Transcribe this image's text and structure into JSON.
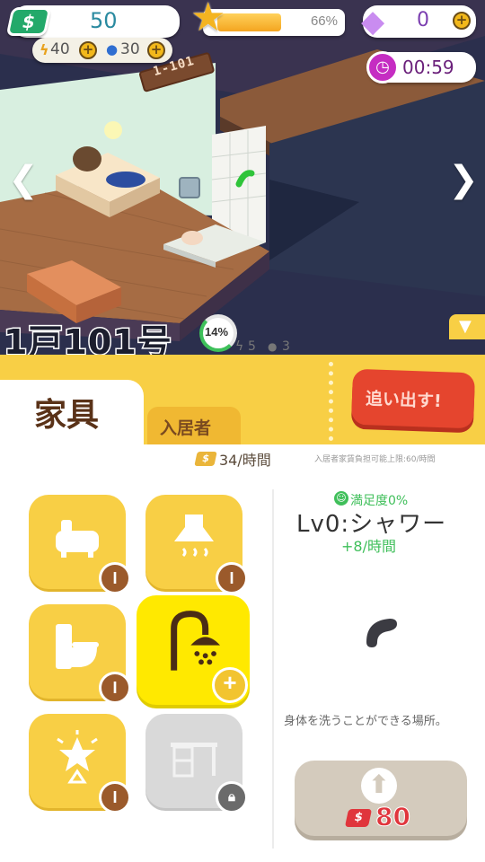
{
  "hud": {
    "money": "50",
    "energy": "40",
    "water": "30",
    "level_progress_pct": 66,
    "level_progress_label": "66%",
    "gems": "0",
    "timer": "00:59"
  },
  "room": {
    "door_sign": "1-101",
    "name": "1戸101号",
    "fill_percent": "14%",
    "stat_energy": "5",
    "stat_water": "3"
  },
  "tabs": {
    "furniture": "家具",
    "residents": "入居者",
    "evict": "追い出す!"
  },
  "income": {
    "value": "34/時間",
    "limit_text": "入居者家賃負担可能上限:60/時間"
  },
  "detail": {
    "satisfaction": "満足度0%",
    "title": "Lv0:シャワー",
    "bonus": "+8/時間",
    "description": "身体を洗うことができる場所。",
    "upgrade_cost": "80"
  },
  "furniture": [
    {
      "icon": "bathtub-icon",
      "level": "I"
    },
    {
      "icon": "range-hood-icon",
      "level": "I"
    },
    {
      "icon": "toilet-icon",
      "level": "I"
    },
    {
      "icon": "shower-icon",
      "level": "+"
    },
    {
      "icon": "ceiling-light-icon",
      "level": "I"
    },
    {
      "icon": "desk-icon",
      "level": "locked"
    }
  ],
  "colors": {
    "yellow": "#f8cf45",
    "bright_yellow": "#ffe900",
    "evict_red": "#e5452e",
    "brown": "#9b5a2b",
    "money_green": "#23a96a"
  }
}
